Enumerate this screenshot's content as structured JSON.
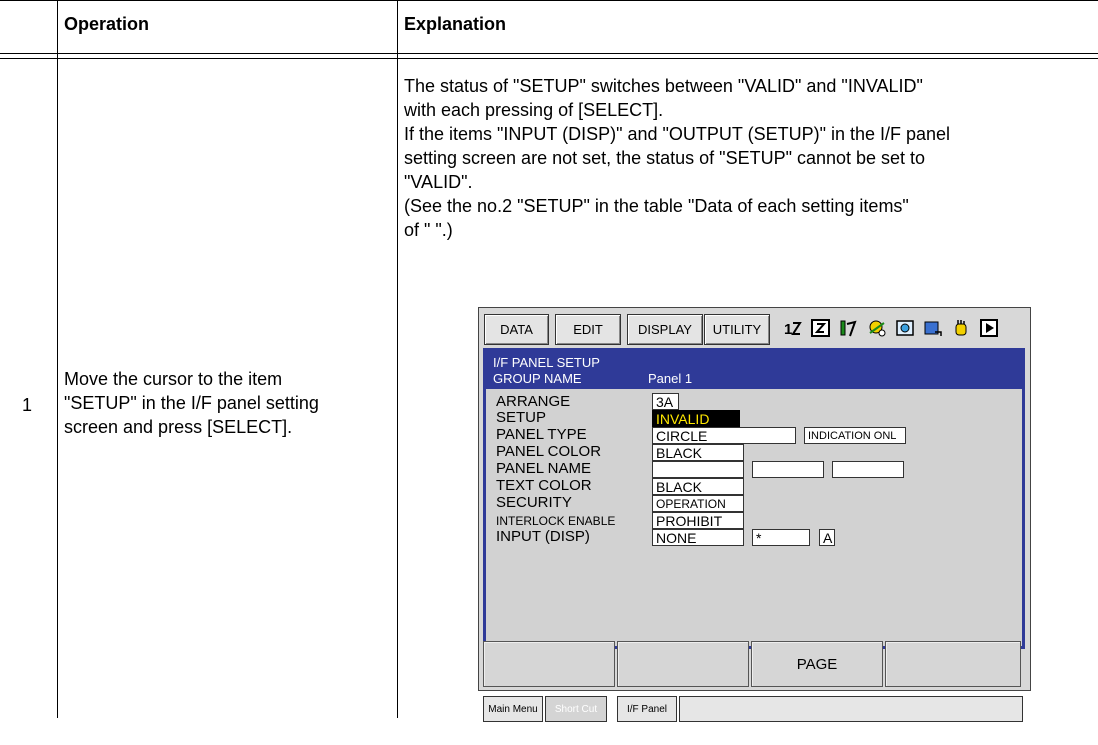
{
  "table": {
    "headers": {
      "operation": "Operation",
      "explanation": "Explanation"
    },
    "rows": [
      {
        "number": "1",
        "operation": [
          "Move the cursor to the item",
          "\"SETUP\" in the I/F panel setting",
          "screen and press [SELECT]."
        ],
        "explanation": [
          "The status of \"SETUP\" switches between \"VALID\" and \"INVALID\"",
          "with each pressing of [SELECT].",
          "If the items \"INPUT (DISP)\" and \"OUTPUT (SETUP)\" in the I/F panel",
          "setting screen are not set, the status of \"SETUP\" cannot be set to",
          "\"VALID\".",
          "(See the no.2 \"SETUP\" in the table \"Data of each setting items\"",
          "of \"    \".)"
        ]
      }
    ]
  },
  "screen": {
    "top_menu": [
      "DATA",
      "EDIT",
      "DISPLAY",
      "UTILITY"
    ],
    "status_icons": [
      "coordinate-icon",
      "teach-mode-icon",
      "job-icon",
      "servo-icon",
      "camera-icon",
      "page-icon",
      "hand-icon",
      "play-icon"
    ],
    "title": "I/F PANEL SETUP",
    "group_name_label": "GROUP NAME",
    "group_name_value": "Panel 1",
    "rows": {
      "arrange": {
        "label": "ARRANGE",
        "value": "3A"
      },
      "setup": {
        "label": "SETUP",
        "value": "INVALID"
      },
      "panel_type": {
        "label": "PANEL TYPE",
        "value": "CIRCLE",
        "extra": "INDICATION ONL"
      },
      "panel_color": {
        "label": "PANEL COLOR",
        "value": "BLACK"
      },
      "panel_name": {
        "label": "PANEL NAME",
        "value": "",
        "extra1": "",
        "extra2": ""
      },
      "text_color": {
        "label": "TEXT COLOR",
        "value": "BLACK"
      },
      "security": {
        "label": "SECURITY",
        "value": "OPERATION"
      },
      "interlock": {
        "label": "INTERLOCK ENABLE",
        "value": "PROHIBIT"
      },
      "input_disp": {
        "label": "INPUT (DISP)",
        "value": "NONE",
        "extra1": "*",
        "extra2": "A"
      }
    },
    "softkeys": [
      "",
      "",
      "PAGE",
      ""
    ],
    "bottom_bar": {
      "main_menu": "Main Menu",
      "short_cut": "Short Cut",
      "if_panel": "I/F Panel"
    },
    "colors": {
      "title_bar": "#2f3a98",
      "selected_bg": "#000000",
      "selected_text": "#ffe800"
    }
  }
}
